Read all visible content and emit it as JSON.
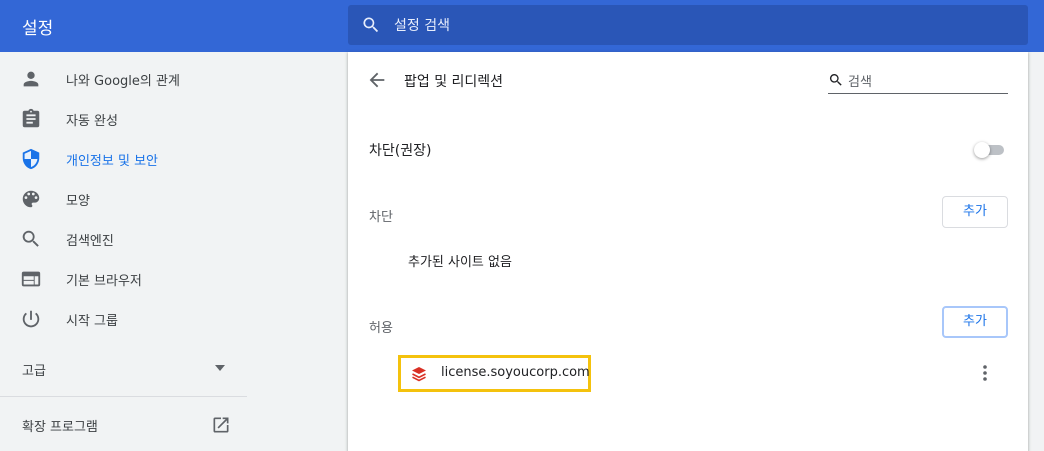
{
  "header": {
    "title": "설정",
    "search_placeholder": "설정 검색"
  },
  "sidebar": {
    "items": [
      {
        "label": "나와 Google의 관계",
        "icon": "person-icon"
      },
      {
        "label": "자동 완성",
        "icon": "clipboard-icon"
      },
      {
        "label": "개인정보 및 보안",
        "icon": "shield-icon",
        "active": true
      },
      {
        "label": "모양",
        "icon": "palette-icon"
      },
      {
        "label": "검색엔진",
        "icon": "search-icon"
      },
      {
        "label": "기본 브라우저",
        "icon": "browser-window-icon"
      },
      {
        "label": "시작 그룹",
        "icon": "power-icon"
      }
    ],
    "advanced_label": "고급",
    "extensions_label": "확장 프로그램"
  },
  "page": {
    "title": "팝업 및 리디렉션",
    "search_placeholder": "검색",
    "toggle": {
      "label": "차단(권장)",
      "enabled": false
    },
    "block": {
      "label": "차단",
      "add_label": "추가",
      "empty_text": "추가된 사이트 없음"
    },
    "allow": {
      "label": "허용",
      "add_label": "추가",
      "sites": [
        {
          "url": "license.soyoucorp.com"
        }
      ]
    }
  },
  "colors": {
    "header": "#3367d6",
    "search_bg": "#2a56b7",
    "accent": "#1a73e8",
    "highlight_border": "#f4c20d",
    "favicon": "#d93025"
  }
}
